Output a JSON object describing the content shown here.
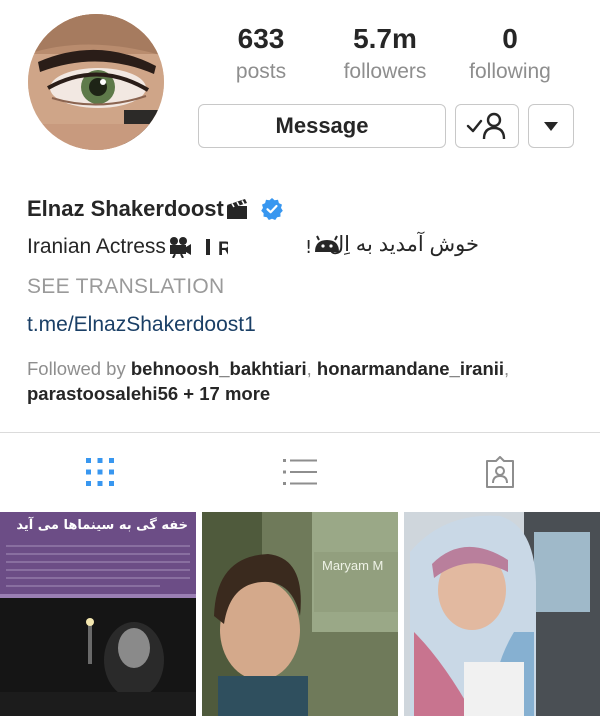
{
  "profile": {
    "name": "Elnaz Shakerdoost",
    "name_badge_icon": "clapperboard-icon",
    "verified_icon": "verified-badge-icon",
    "bio_en": "Iranian Actress",
    "bio_fa": "خوش آمدید به اِل",
    "see_translation": "SEE TRANSLATION",
    "link": "t.me/ElnazShakerdoost1"
  },
  "stats": {
    "posts": {
      "value": "633",
      "label": "posts"
    },
    "followers": {
      "value": "5.7m",
      "label": "followers"
    },
    "following": {
      "value": "0",
      "label": "following"
    }
  },
  "actions": {
    "message_label": "Message",
    "follow_icon": "user-check-icon",
    "more_icon": "caret-down-icon"
  },
  "followed_by": {
    "prefix": "Followed by",
    "users": [
      "behnoosh_bakhtiari",
      "honarmandane_iranii",
      "parastoosalehi56"
    ],
    "more": "+ 17 more"
  },
  "tabs": [
    {
      "icon": "grid-icon",
      "active": true
    },
    {
      "icon": "list-icon",
      "active": false
    },
    {
      "icon": "tagged-icon",
      "active": false
    }
  ],
  "posts": [
    {
      "caption": "خفه گی به سینماها می آید"
    },
    {
      "caption": "Maryam M"
    },
    {
      "caption": ""
    }
  ],
  "colors": {
    "text": "#262626",
    "muted": "#8e8e8e",
    "link": "#1a3f66",
    "verified": "#3897f0",
    "active_tab": "#3897f0",
    "border": "#dbdbdb"
  }
}
